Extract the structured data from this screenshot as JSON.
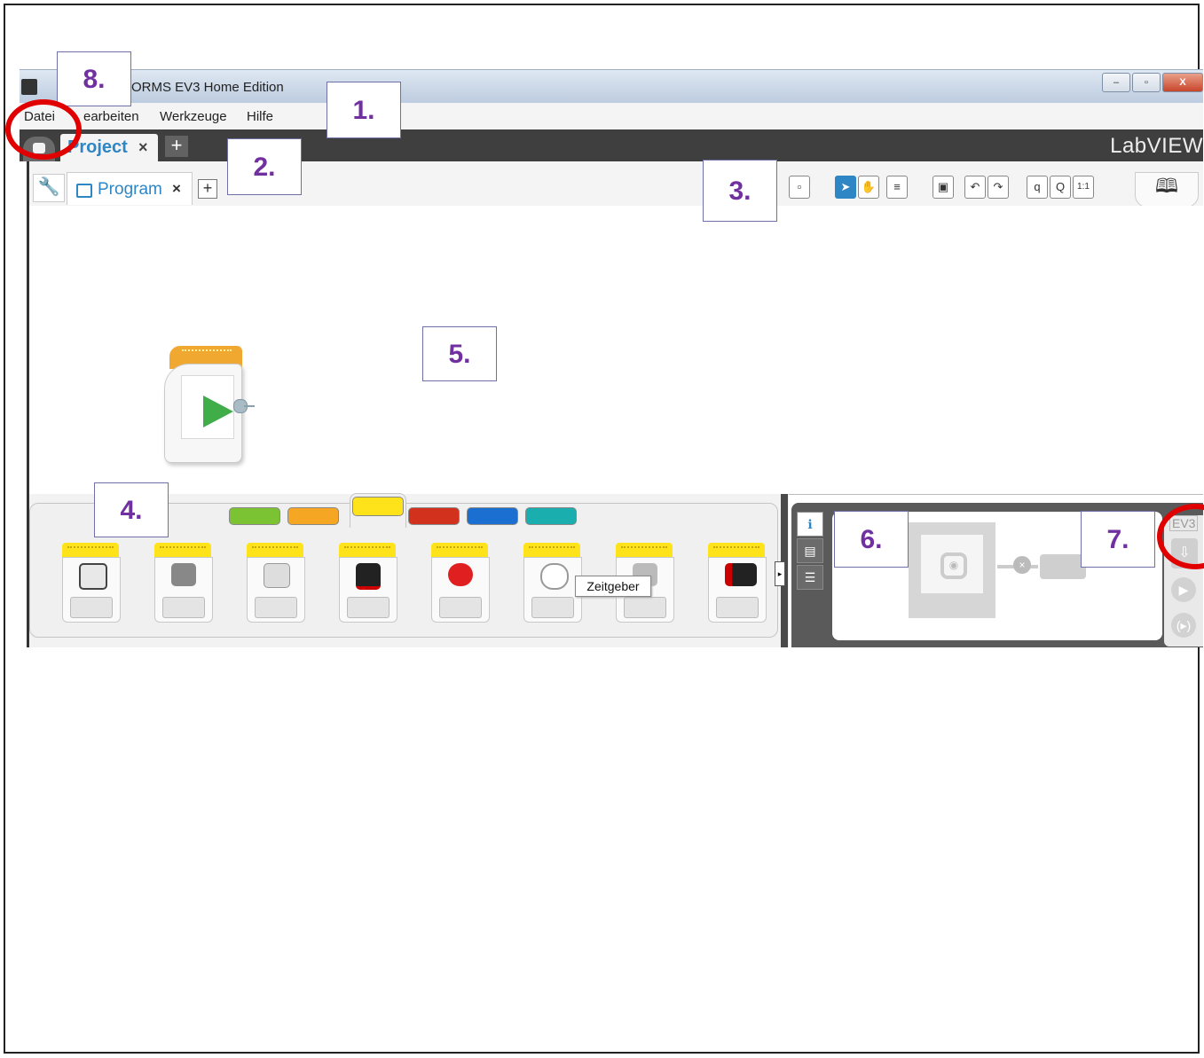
{
  "window": {
    "title": "LEGO MINDSTORMS EV3 Home Edition",
    "title_visible": "ORMS EV3 Home Edition",
    "controls": [
      "–",
      "▫",
      "X"
    ]
  },
  "menubar": {
    "items": [
      "Datei",
      "Bearbeiten",
      "Werkzeuge",
      "Hilfe"
    ],
    "items_visible": [
      "Datei",
      "earbeiten",
      "Werkzeuge",
      "Hilfe"
    ]
  },
  "project_bar": {
    "tab_label": "Project",
    "close": "×",
    "add": "+",
    "brand": "LabVIEW",
    "brand_visible": "LabVIEW"
  },
  "program_bar": {
    "tab_label": "Program",
    "close": "×",
    "add": "+",
    "zoom_reset": "1:1"
  },
  "palette": {
    "tab_colors": [
      "#7cc334",
      "#f5a623",
      "#ffe31a",
      "#d2321d",
      "#1a6fd1",
      "#1aaeae"
    ],
    "selected_tab": 2,
    "block_icons": [
      "medium-motor",
      "large-motor",
      "ev3-brick",
      "ir-sensor",
      "brick-buttons",
      "timer",
      "touch-sensor",
      "color-sensor"
    ],
    "tooltip": "Zeitgeber"
  },
  "hardware_page": {
    "brick_label": "EV3"
  },
  "annotations": [
    "1.",
    "2.",
    "3.",
    "4.",
    "5.",
    "6.",
    "7.",
    "8."
  ]
}
